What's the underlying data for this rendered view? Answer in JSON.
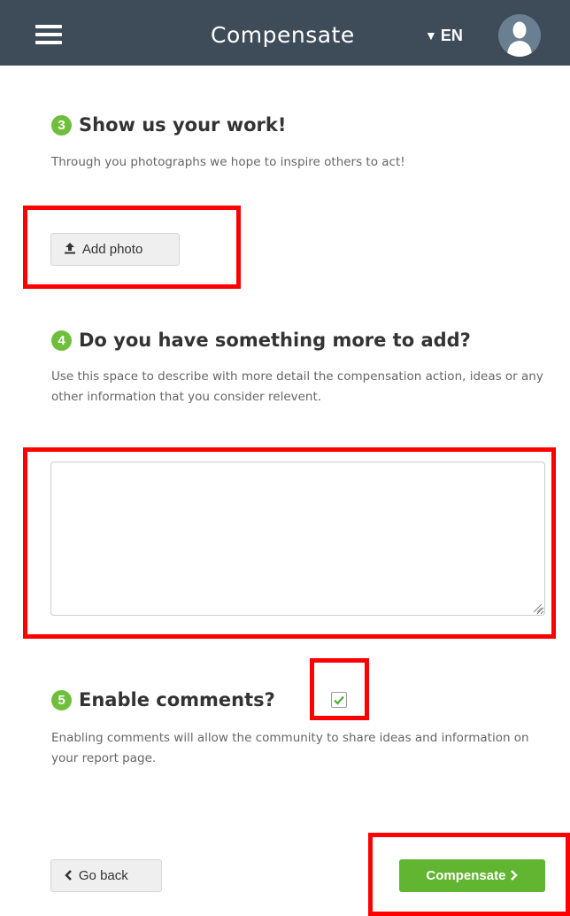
{
  "header": {
    "title": "Compensate",
    "language": "EN",
    "language_arrow": "▼",
    "menu_icon": "hamburger-menu-icon",
    "avatar_icon": "user-avatar-icon"
  },
  "section3": {
    "number": "3",
    "title": "Show us your work!",
    "description": "Through you photographs we hope to inspire others to act!",
    "add_photo_label": "Add photo",
    "add_photo_icon": "upload-icon"
  },
  "section4": {
    "number": "4",
    "title": "Do you have something more to add?",
    "description": "Use this space to describe with more detail the compensation action, ideas or any other information that you consider relevent.",
    "textarea_value": ""
  },
  "section5": {
    "number": "5",
    "title": "Enable comments?",
    "checkbox_checked": true,
    "description": "Enabling comments will allow the community to share ideas and information on your report page."
  },
  "footer": {
    "back_label": "Go back",
    "back_icon": "chevron-left-icon",
    "submit_label": "Compensate",
    "submit_icon": "chevron-right-icon"
  },
  "colors": {
    "header_bg": "#3e4c59",
    "accent_green": "#62b530",
    "highlight_red": "#ff0000"
  }
}
